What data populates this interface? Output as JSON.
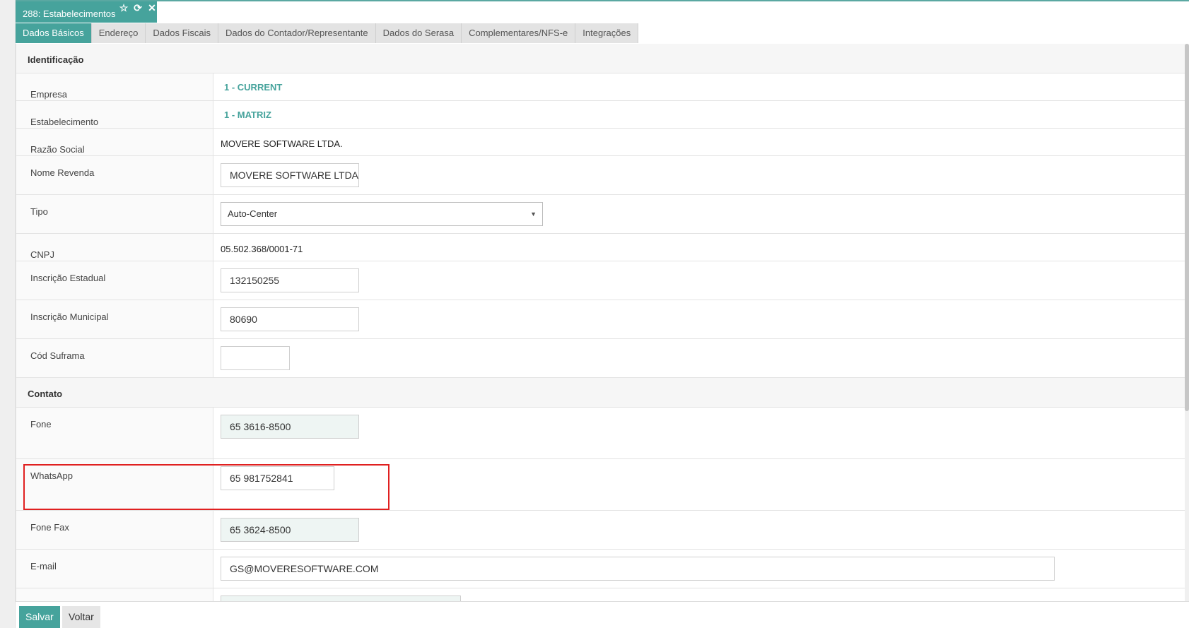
{
  "window": {
    "tab_title": "288: Estabelecimentos",
    "icons": [
      "star-icon",
      "refresh-icon",
      "close-icon"
    ]
  },
  "subtabs": [
    {
      "label": "Dados Básicos",
      "active": true
    },
    {
      "label": "Endereço",
      "active": false
    },
    {
      "label": "Dados Fiscais",
      "active": false
    },
    {
      "label": "Dados do Contador/Representante",
      "active": false
    },
    {
      "label": "Dados do Serasa",
      "active": false
    },
    {
      "label": "Complementares/NFS-e",
      "active": false
    },
    {
      "label": "Integrações",
      "active": false
    }
  ],
  "identificacao": {
    "section_title": "Identificação",
    "empresa": {
      "label": "Empresa",
      "value": "1 - CURRENT"
    },
    "estabelecimento": {
      "label": "Estabelecimento",
      "value": "1 - MATRIZ"
    },
    "razao_social": {
      "label": "Razão Social",
      "value": "MOVERE SOFTWARE LTDA."
    },
    "nome_revenda": {
      "label": "Nome Revenda",
      "value": "MOVERE SOFTWARE LTDA"
    },
    "tipo": {
      "label": "Tipo",
      "value": "Auto-Center"
    },
    "cnpj": {
      "label": "CNPJ",
      "value": "05.502.368/0001-71"
    },
    "inscricao_estadual": {
      "label": "Inscrição Estadual",
      "value": "132150255"
    },
    "inscricao_municipal": {
      "label": "Inscrição Municipal",
      "value": "80690"
    },
    "cod_suframa": {
      "label": "Cód Suframa",
      "value": ""
    }
  },
  "contato": {
    "section_title": "Contato",
    "fone": {
      "label": "Fone",
      "value": "65 3616-8500"
    },
    "whatsapp": {
      "label": "WhatsApp",
      "value": "65 981752841"
    },
    "fone_fax": {
      "label": "Fone Fax",
      "value": "65 3624-8500"
    },
    "email": {
      "label": "E-mail",
      "value": "GS@MOVERESOFTWARE.COM"
    }
  },
  "actions": {
    "save_label": "Salvar",
    "back_label": "Voltar"
  },
  "colors": {
    "accent": "#46a39c",
    "highlight": "#e02020"
  }
}
